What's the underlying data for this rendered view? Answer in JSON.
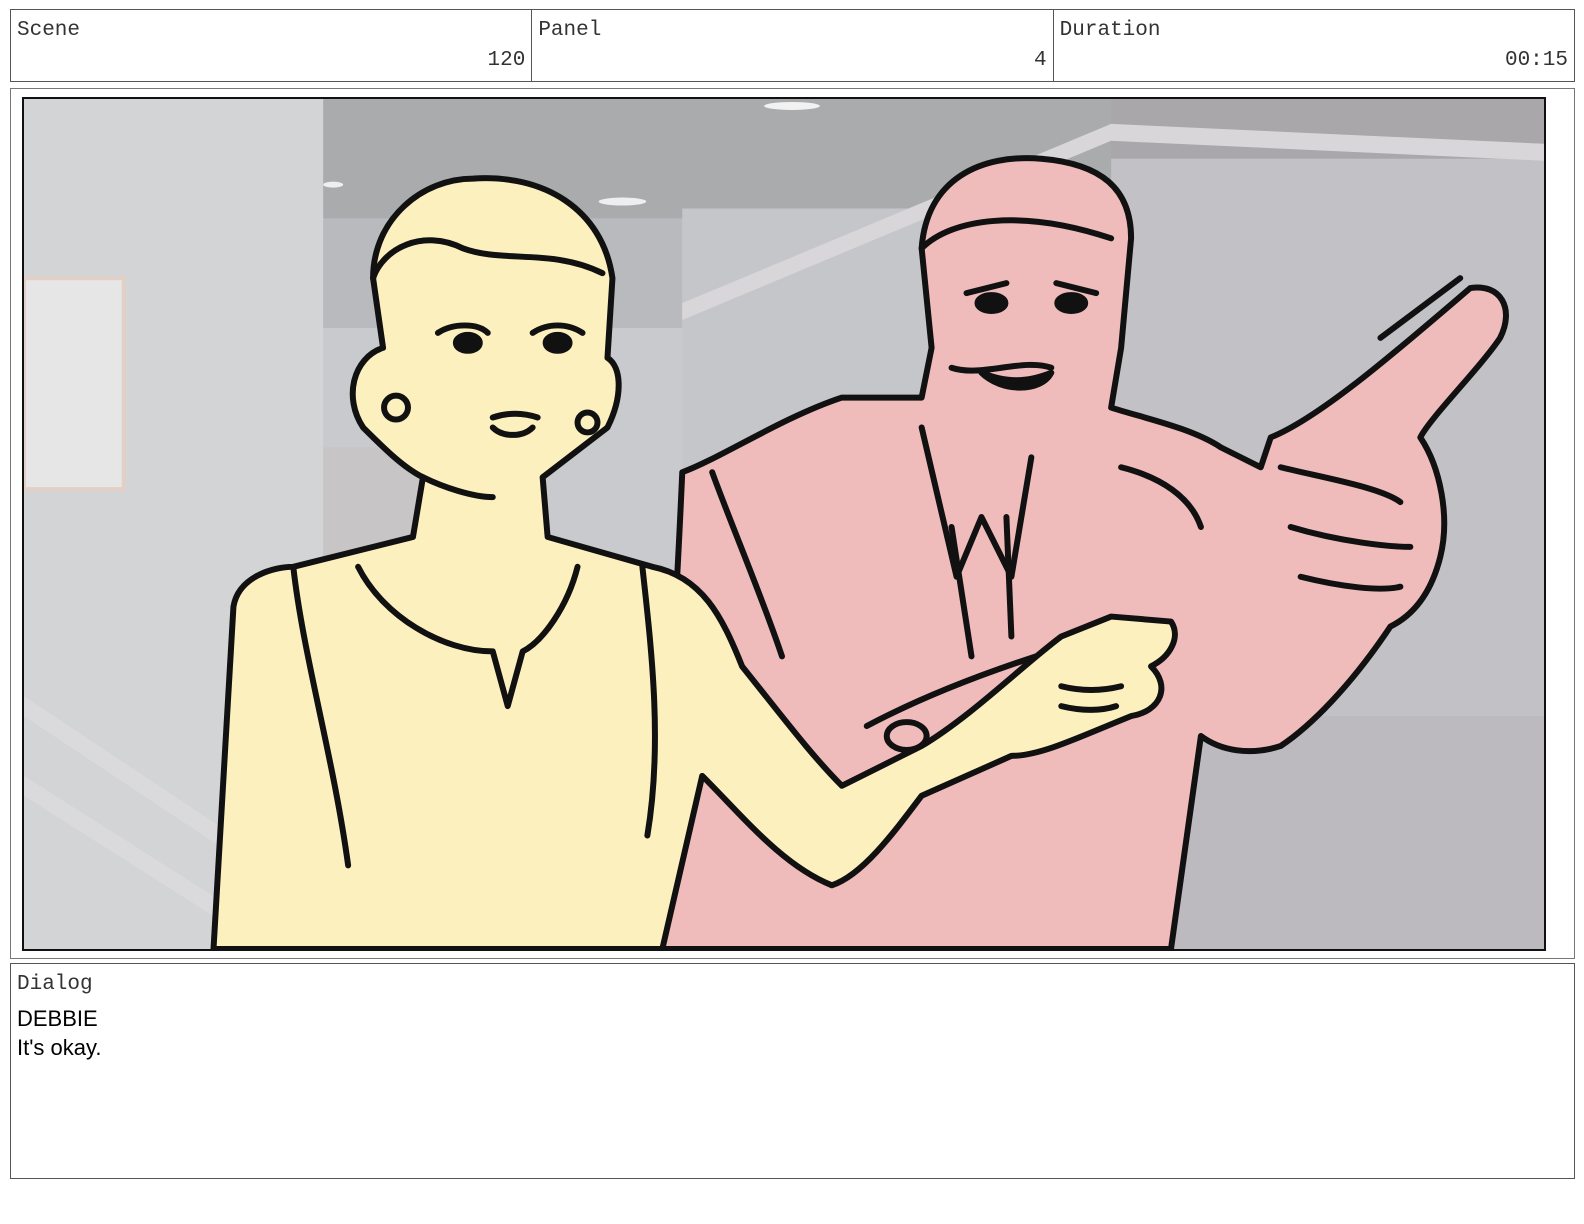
{
  "header": {
    "scene": {
      "label": "Scene",
      "value": "120"
    },
    "panel": {
      "label": "Panel",
      "value": "4"
    },
    "duration": {
      "label": "Duration",
      "value": "00:15"
    }
  },
  "artwork": {
    "subject_icons": [
      "woman-character",
      "man-character-pointing"
    ],
    "colors": {
      "woman_fill": "#fdf0bf",
      "man_fill": "#efbcbb",
      "background": "#c7c9cc",
      "ink": "#111111"
    }
  },
  "dialog": {
    "label": "Dialog",
    "character": "DEBBIE",
    "line": "It's okay."
  }
}
